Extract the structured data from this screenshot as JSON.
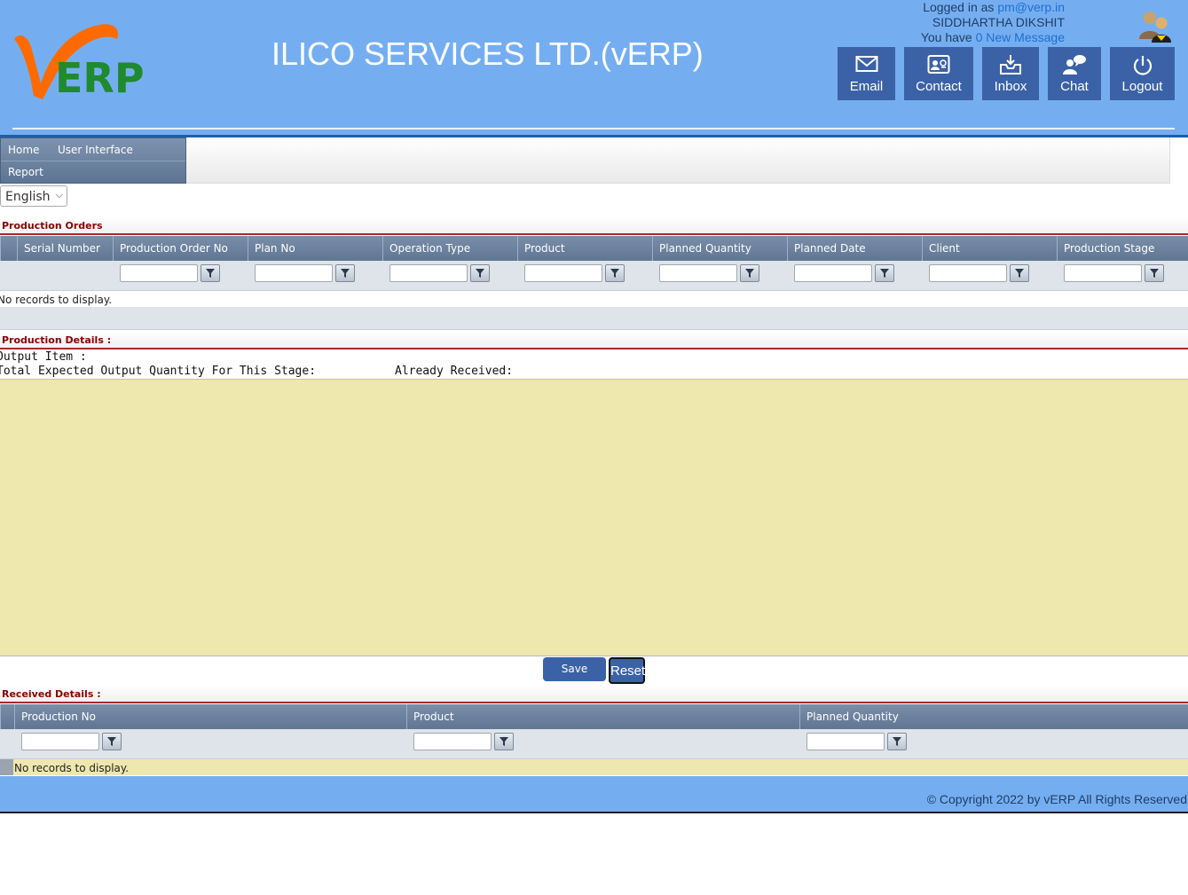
{
  "header": {
    "company": "ILICO SERVICES LTD.(vERP)",
    "logged_in_prefix": "Logged in as ",
    "logged_in_email": "pm@verp.in",
    "user_name": "SIDDHARTHA DIKSHIT",
    "message_prefix": "You have ",
    "message_link": "0 New Message",
    "buttons": [
      {
        "label": "Email",
        "icon": "envelope-icon"
      },
      {
        "label": "Contact",
        "icon": "contact-card-icon"
      },
      {
        "label": "Inbox",
        "icon": "inbox-icon"
      },
      {
        "label": "Chat",
        "icon": "chat-icon"
      },
      {
        "label": "Logout",
        "icon": "power-icon"
      }
    ]
  },
  "menu": {
    "items": [
      "Home",
      "User Interface",
      "Report"
    ]
  },
  "language": {
    "selected": "English"
  },
  "production_orders": {
    "title": "Production Orders",
    "columns": [
      "Serial Number",
      "Production Order No",
      "Plan No",
      "Operation Type",
      "Product",
      "Planned Quantity",
      "Planned Date",
      "Client",
      "Production Stage"
    ],
    "empty_text": "No records to display."
  },
  "production_details": {
    "title": "Production Details :",
    "output_item_label": "Output Item :",
    "total_expected_label": "Total Expected Output Quantity For This Stage:",
    "already_received_label": "Already Received:"
  },
  "actions": {
    "save": "Save",
    "reset": "Reset"
  },
  "received_details": {
    "title": "Received Details :",
    "columns": [
      "Production No",
      "Product",
      "Planned Quantity"
    ],
    "empty_text": "No records to display."
  },
  "footer": {
    "copyright": "© Copyright 2022 by vERP All Rights Reserved"
  },
  "colors": {
    "header_blue": "#75aef0",
    "button_blue": "#3b62a7",
    "section_red": "#8b0000",
    "detail_yellow": "#eee8ae"
  }
}
